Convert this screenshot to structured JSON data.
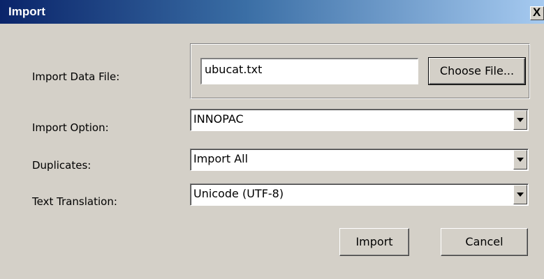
{
  "window": {
    "title": "Import",
    "close_glyph": "X"
  },
  "form": {
    "file": {
      "label": "Import Data File:",
      "value": "ubucat.txt",
      "choose_label": "Choose File..."
    },
    "option": {
      "label": "Import Option:",
      "selected": "INNOPAC"
    },
    "duplicates": {
      "label": "Duplicates:",
      "selected": "Import All"
    },
    "translation": {
      "label": "Text Translation:",
      "selected": "Unicode (UTF-8)"
    }
  },
  "buttons": {
    "import": "Import",
    "cancel": "Cancel"
  },
  "colors": {
    "dialog_bg": "#d4d0c8",
    "title_start": "#0a246a",
    "title_end": "#a6caf0",
    "title_text": "#ffffff"
  },
  "icons": {
    "close": "close-icon",
    "dropdown": "chevron-down-icon"
  }
}
